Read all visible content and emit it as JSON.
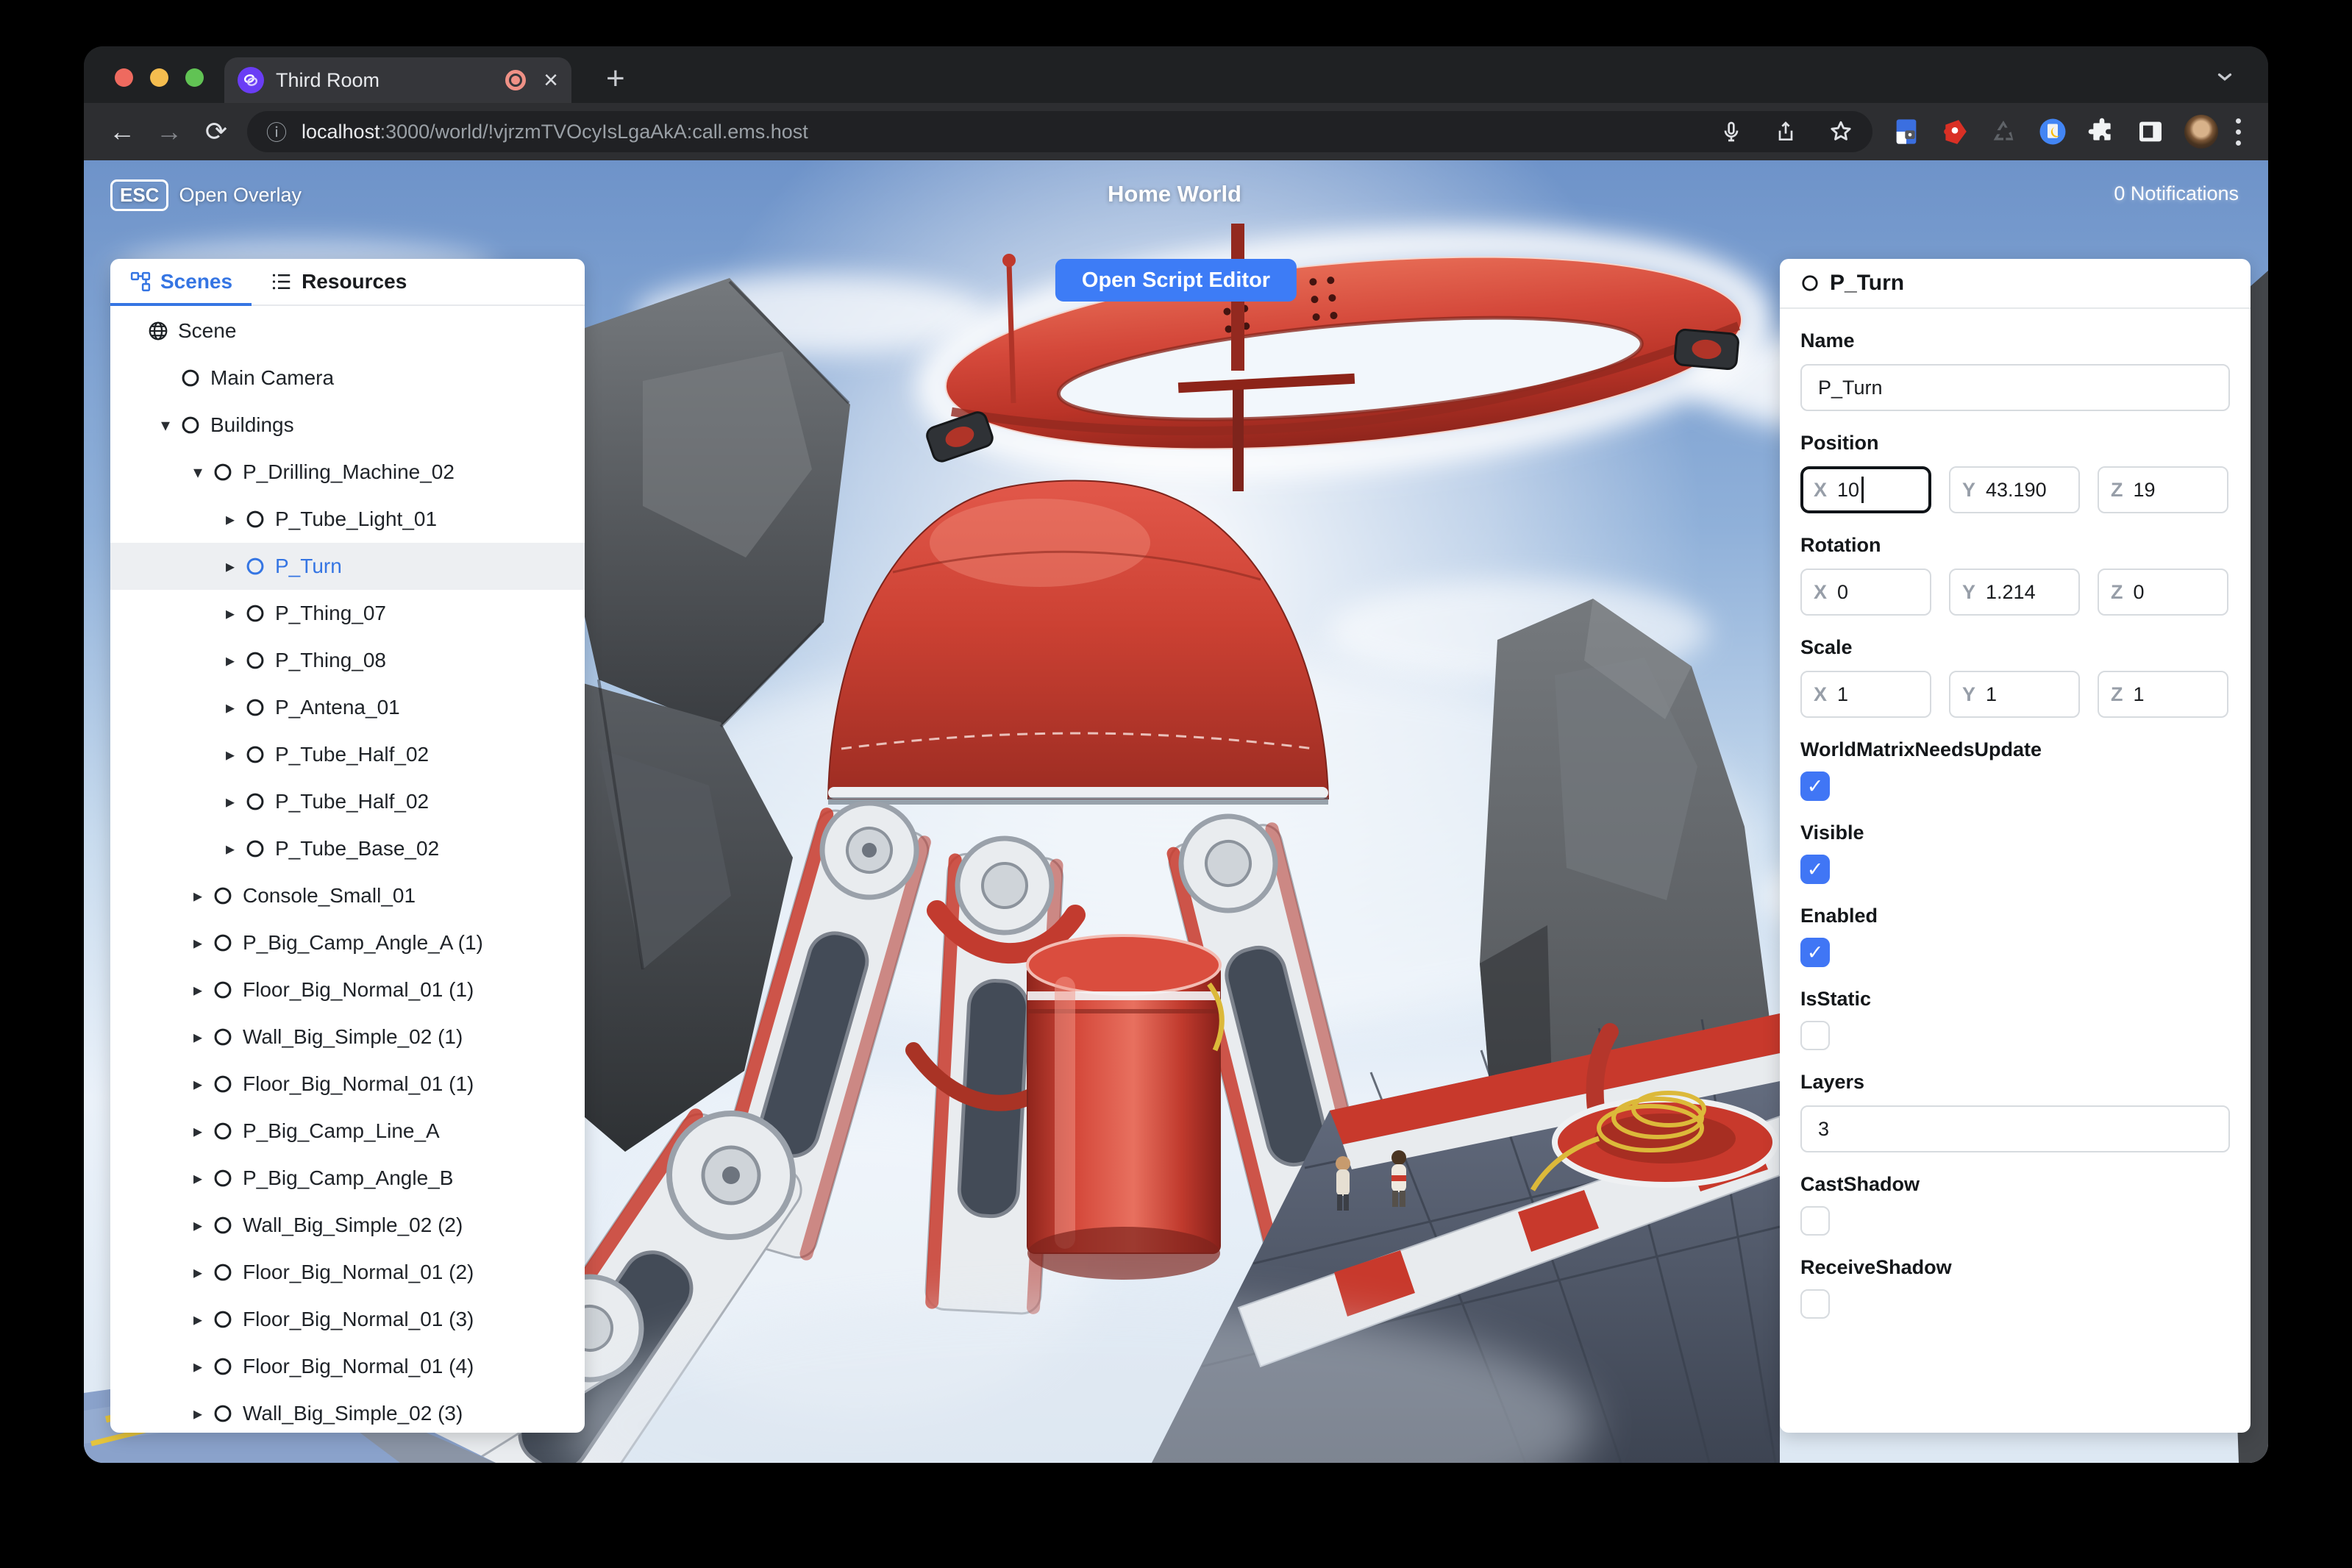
{
  "browser": {
    "tab": {
      "title": "Third Room",
      "close_label": "×"
    },
    "new_tab_label": "+",
    "url": {
      "host": "localhost",
      "rest": ":3000/world/!vjrzmTVOcyIsLgaAkA:call.ems.host"
    }
  },
  "topbar": {
    "esc_key": "ESC",
    "open_overlay_label": "Open Overlay",
    "world_title": "Home World",
    "notifications_label": "0 Notifications"
  },
  "left_panel": {
    "tabs": [
      {
        "label": "Scenes",
        "active": true
      },
      {
        "label": "Resources",
        "active": false
      }
    ],
    "tree": [
      {
        "label": "Scene",
        "level": 0,
        "arrow": "none",
        "icon": "globe",
        "selected": false
      },
      {
        "label": "Main Camera",
        "level": 1,
        "arrow": "none",
        "icon": "circle",
        "selected": false
      },
      {
        "label": "Buildings",
        "level": 1,
        "arrow": "down",
        "icon": "circle",
        "selected": false
      },
      {
        "label": "P_Drilling_Machine_02",
        "level": 2,
        "arrow": "down",
        "icon": "circle",
        "selected": false
      },
      {
        "label": "P_Tube_Light_01",
        "level": 3,
        "arrow": "right",
        "icon": "circle",
        "selected": false
      },
      {
        "label": "P_Turn",
        "level": 3,
        "arrow": "right",
        "icon": "circle",
        "selected": true
      },
      {
        "label": "P_Thing_07",
        "level": 3,
        "arrow": "right",
        "icon": "circle",
        "selected": false
      },
      {
        "label": "P_Thing_08",
        "level": 3,
        "arrow": "right",
        "icon": "circle",
        "selected": false
      },
      {
        "label": "P_Antena_01",
        "level": 3,
        "arrow": "right",
        "icon": "circle",
        "selected": false
      },
      {
        "label": "P_Tube_Half_02",
        "level": 3,
        "arrow": "right",
        "icon": "circle",
        "selected": false
      },
      {
        "label": "P_Tube_Half_02",
        "level": 3,
        "arrow": "right",
        "icon": "circle",
        "selected": false
      },
      {
        "label": "P_Tube_Base_02",
        "level": 3,
        "arrow": "right",
        "icon": "circle",
        "selected": false
      },
      {
        "label": "Console_Small_01",
        "level": 2,
        "arrow": "right",
        "icon": "circle",
        "selected": false
      },
      {
        "label": "P_Big_Camp_Angle_A (1)",
        "level": 2,
        "arrow": "right",
        "icon": "circle",
        "selected": false
      },
      {
        "label": "Floor_Big_Normal_01 (1)",
        "level": 2,
        "arrow": "right",
        "icon": "circle",
        "selected": false
      },
      {
        "label": "Wall_Big_Simple_02 (1)",
        "level": 2,
        "arrow": "right",
        "icon": "circle",
        "selected": false
      },
      {
        "label": "Floor_Big_Normal_01 (1)",
        "level": 2,
        "arrow": "right",
        "icon": "circle",
        "selected": false
      },
      {
        "label": "P_Big_Camp_Line_A",
        "level": 2,
        "arrow": "right",
        "icon": "circle",
        "selected": false
      },
      {
        "label": "P_Big_Camp_Angle_B",
        "level": 2,
        "arrow": "right",
        "icon": "circle",
        "selected": false
      },
      {
        "label": "Wall_Big_Simple_02 (2)",
        "level": 2,
        "arrow": "right",
        "icon": "circle",
        "selected": false
      },
      {
        "label": "Floor_Big_Normal_01 (2)",
        "level": 2,
        "arrow": "right",
        "icon": "circle",
        "selected": false
      },
      {
        "label": "Floor_Big_Normal_01 (3)",
        "level": 2,
        "arrow": "right",
        "icon": "circle",
        "selected": false
      },
      {
        "label": "Floor_Big_Normal_01 (4)",
        "level": 2,
        "arrow": "right",
        "icon": "circle",
        "selected": false
      },
      {
        "label": "Wall_Big_Simple_02 (3)",
        "level": 2,
        "arrow": "right",
        "icon": "circle",
        "selected": false
      }
    ]
  },
  "viewport": {
    "open_script_editor_label": "Open Script Editor"
  },
  "inspector": {
    "title": "P_Turn",
    "name": {
      "label": "Name",
      "value": "P_Turn"
    },
    "position": {
      "label": "Position",
      "fields": [
        {
          "prefix": "X",
          "value": "10",
          "focused": true
        },
        {
          "prefix": "Y",
          "value": "43.190",
          "focused": false
        },
        {
          "prefix": "Z",
          "value": "19",
          "focused": false
        }
      ]
    },
    "rotation": {
      "label": "Rotation",
      "fields": [
        {
          "prefix": "X",
          "value": "0",
          "focused": false
        },
        {
          "prefix": "Y",
          "value": "1.214",
          "focused": false
        },
        {
          "prefix": "Z",
          "value": "0",
          "focused": false
        }
      ]
    },
    "scale": {
      "label": "Scale",
      "fields": [
        {
          "prefix": "X",
          "value": "1",
          "focused": false
        },
        {
          "prefix": "Y",
          "value": "1",
          "focused": false
        },
        {
          "prefix": "Z",
          "value": "1",
          "focused": false
        }
      ]
    },
    "world_matrix": {
      "label": "WorldMatrixNeedsUpdate",
      "checked": true
    },
    "visible": {
      "label": "Visible",
      "checked": true
    },
    "enabled": {
      "label": "Enabled",
      "checked": true
    },
    "is_static": {
      "label": "IsStatic",
      "checked": false
    },
    "layers": {
      "label": "Layers",
      "value": "3"
    },
    "cast_shadow": {
      "label": "CastShadow",
      "checked": false
    },
    "receive_shadow": {
      "label": "ReceiveShadow",
      "checked": false
    }
  },
  "colors": {
    "accent_blue": "#3575e3",
    "button_blue": "#3d7cf6",
    "checkbox_blue": "#4076f5",
    "machine_red": "#c43a2e"
  }
}
